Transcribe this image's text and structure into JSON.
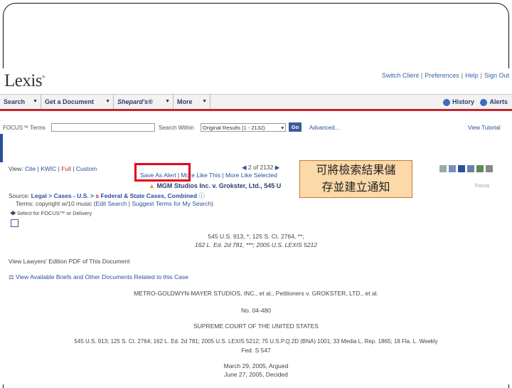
{
  "header": {
    "logo": "Lexis",
    "logo_mark": "®",
    "top_links": [
      "Switch Client",
      "Preferences",
      "Help",
      "Sign Out"
    ]
  },
  "nav": {
    "items": [
      "Search",
      "Get a Document",
      "Shepard's®",
      "More"
    ],
    "history": "History",
    "alerts": "Alerts"
  },
  "focus": {
    "label": "FOCUS™ Terms",
    "search_within_label": "Search Within",
    "search_within_value": "Original Results (1 - 2132)",
    "go": "Go",
    "advanced": "Advanced...",
    "view_tutorial": "View Tutorial"
  },
  "toolbar": {
    "view_label": "View:",
    "views": [
      "Cite",
      "KWIC",
      "Full",
      "Custom"
    ],
    "pager": "2 of 2132",
    "save_as_alert": "Save As Alert",
    "more_like_this": "More Like This",
    "more_like_selected": "More Like Selected",
    "focus_note": "Focus"
  },
  "doc": {
    "case_title_short": "MGM Studios Inc. v. Grokster, Ltd., 545 U",
    "source_label": "Source:",
    "source_path": "Legal > Cases - U.S. >",
    "source_end": "Federal & State Cases, Combined",
    "terms_label": "Terms: copyright w/10 music",
    "terms_links": [
      "Edit Search",
      "Suggest Terms for My Search"
    ],
    "select_focus": "Select for FOCUS™ or Delivery",
    "citation_line1": "545 U.S. 913, *; 125 S. Ct. 2764, **;",
    "citation_line2": "162 L. Ed. 2d 781, ***; 2005 U.S. LEXIS 5212",
    "lawyers_edition": "View Lawyers' Edition PDF of This Document",
    "view_briefs": "View Available Briefs and Other Documents Related to this Case",
    "parties": "METRO-GOLDWYN-MAYER STUDIOS, INC., et al., Petitioners v. GROKSTER, LTD., et al.",
    "docket": "No. 04-480",
    "court": "SUPREME COURT OF THE UNITED STATES",
    "parallel_cite_1": "545 U.S. 913; 125 S. Ct. 2764; 162 L. Ed. 2d 781; 2005 U.S. LEXIS 5212; 75 U.S.P.Q.2D (BNA) 1001; 33 Media L. Rep. 1865; 18 Fla. L. Weekly",
    "parallel_cite_2": "Fed. S 547",
    "argued": "March 29, 2005, Argued",
    "decided": "June 27, 2005, Decided"
  },
  "callout": {
    "line1": "可將檢索結果儲",
    "line2": "存並建立通知"
  },
  "colors": {
    "link_blue": "#2a4f9e",
    "nav_red": "#c3262e",
    "highlight_red": "#e3001b",
    "callout_bg": "#fcd9a8"
  }
}
